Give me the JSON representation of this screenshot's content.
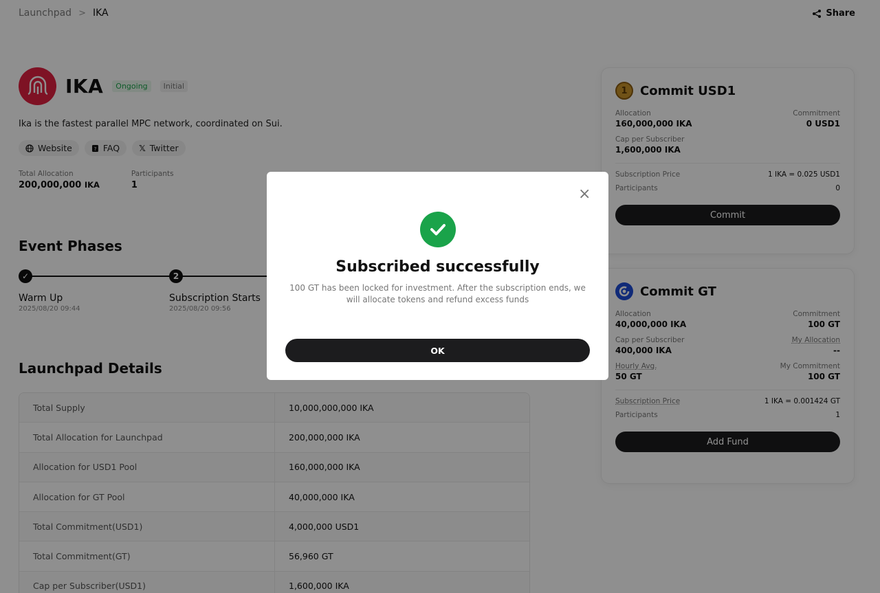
{
  "breadcrumb": {
    "root": "Launchpad",
    "separator": ">",
    "current": "IKA"
  },
  "share_label": "Share",
  "project": {
    "name": "IKA",
    "status": "Ongoing",
    "type": "Initial",
    "description": "Ika is the fastest parallel MPC network, coordinated on Sui.",
    "links": {
      "website": "Website",
      "faq": "FAQ",
      "twitter": "Twitter"
    },
    "total_allocation_label": "Total Allocation",
    "total_allocation_value": "200,000,000",
    "total_allocation_unit": "IKA",
    "participants_label": "Participants",
    "participants_value": "1"
  },
  "phases": {
    "title": "Event Phases",
    "items": [
      {
        "step": "✓",
        "name": "Warm Up",
        "date": "2025/08/20 09:44"
      },
      {
        "step": "2",
        "name": "Subscription Starts",
        "date": "2025/08/20 09:56"
      }
    ]
  },
  "details": {
    "title": "Launchpad Details",
    "rows": [
      {
        "label": "Total Supply",
        "value": "10,000,000,000 IKA"
      },
      {
        "label": "Total Allocation for Launchpad",
        "value": "200,000,000 IKA"
      },
      {
        "label": "Allocation for USD1 Pool",
        "value": "160,000,000 IKA"
      },
      {
        "label": "Allocation for GT Pool",
        "value": "40,000,000 IKA"
      },
      {
        "label": "Total Commitment(USD1)",
        "value": "4,000,000 USD1"
      },
      {
        "label": "Total Commitment(GT)",
        "value": "56,960 GT"
      },
      {
        "label": "Cap per Subscriber(USD1)",
        "value": "1,600,000 IKA"
      }
    ]
  },
  "usd1_card": {
    "title": "Commit USD1",
    "allocation_label": "Allocation",
    "allocation_value": "160,000,000 IKA",
    "commitment_label": "Commitment",
    "commitment_value": "0 USD1",
    "cap_label": "Cap per Subscriber",
    "cap_value": "1,600,000 IKA",
    "price_label": "Subscription Price",
    "price_value": "1 IKA = 0.025 USD1",
    "participants_label": "Participants",
    "participants_value": "0",
    "button": "Commit"
  },
  "gt_card": {
    "title": "Commit GT",
    "allocation_label": "Allocation",
    "allocation_value": "40,000,000 IKA",
    "commitment_label": "Commitment",
    "commitment_value": "100 GT",
    "cap_label": "Cap per Subscriber",
    "cap_value": "400,000 IKA",
    "my_allocation_label": "My Allocation",
    "my_allocation_value": "--",
    "hourly_label": "Hourly Avg.",
    "hourly_value": "50 GT",
    "my_commitment_label": "My Commitment",
    "my_commitment_value": "100 GT",
    "price_label": "Subscription Price",
    "price_value": "1 IKA = 0.001424 GT",
    "participants_label": "Participants",
    "participants_value": "1",
    "button": "Add Fund"
  },
  "modal": {
    "title": "Subscribed successfully",
    "message": "100 GT has been locked for investment. After the subscription ends, we will allocate tokens and refund excess funds",
    "ok": "OK",
    "close": "×"
  },
  "colors": {
    "accent_green": "#1aa34a",
    "brand_red": "#e02040",
    "gt_blue": "#1e4bd6",
    "button_dark": "#1c1c1e"
  }
}
